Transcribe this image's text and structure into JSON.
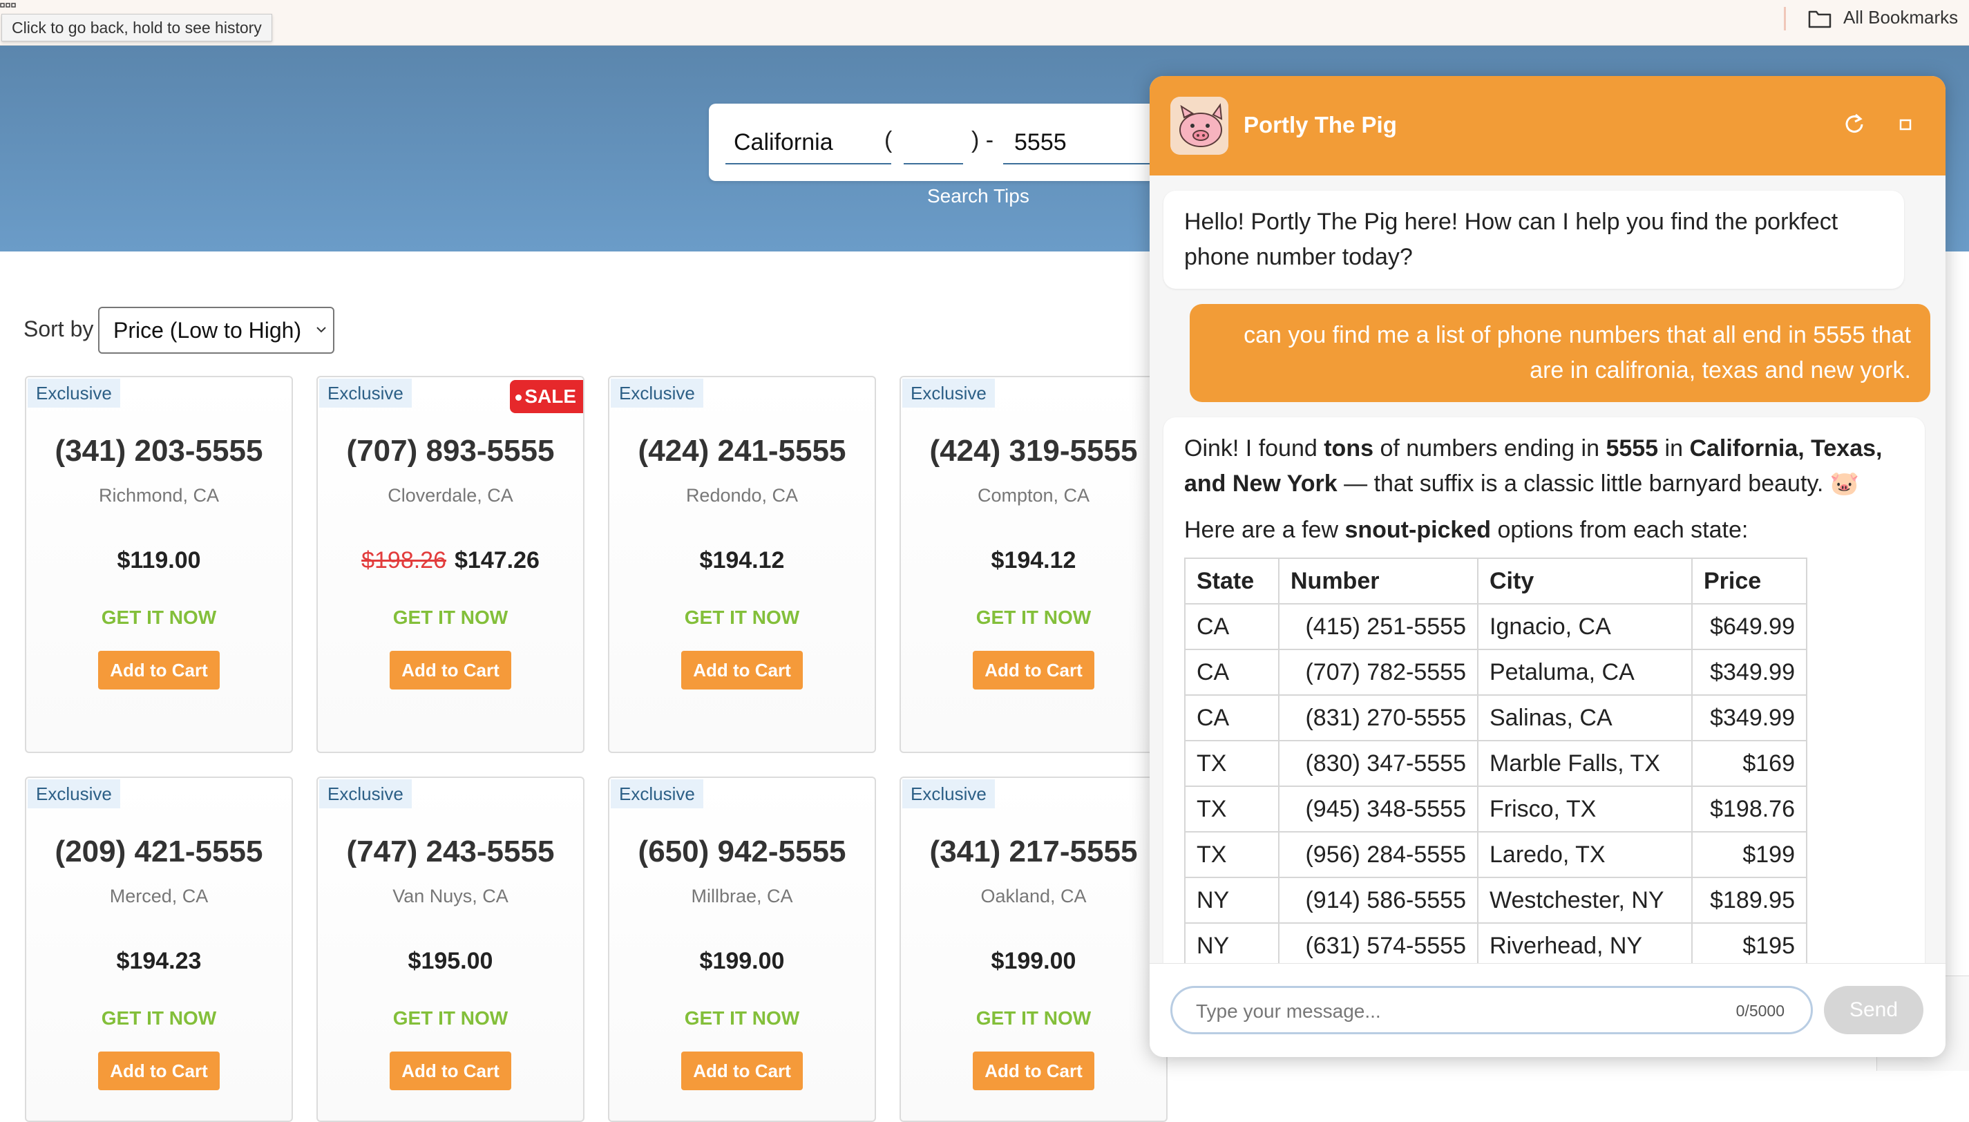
{
  "browser": {
    "tooltip": "Click to go back, hold to see history",
    "bookmarks_label": "All Bookmarks"
  },
  "search": {
    "state": "California",
    "paren_open": "(",
    "area_code": "",
    "paren_close": ") -",
    "suffix": "5555",
    "tips": "Search Tips"
  },
  "sort": {
    "label": "Sort by",
    "selected": "Price (Low to High)"
  },
  "cards": [
    {
      "badge": "Exclusive",
      "phone": "(341) 203-5555",
      "city": "Richmond, CA",
      "old_price": "",
      "price": "$119.00",
      "cta": "GET IT NOW",
      "button": "Add to Cart",
      "sale": false
    },
    {
      "badge": "Exclusive",
      "phone": "(707) 893-5555",
      "city": "Cloverdale, CA",
      "old_price": "$198.26",
      "price": "$147.26",
      "cta": "GET IT NOW",
      "button": "Add to Cart",
      "sale": true,
      "sale_label": "SALE"
    },
    {
      "badge": "Exclusive",
      "phone": "(424) 241-5555",
      "city": "Redondo, CA",
      "old_price": "",
      "price": "$194.12",
      "cta": "GET IT NOW",
      "button": "Add to Cart",
      "sale": false
    },
    {
      "badge": "Exclusive",
      "phone": "(424) 319-5555",
      "city": "Compton, CA",
      "old_price": "",
      "price": "$194.12",
      "cta": "GET IT NOW",
      "button": "Add to Cart",
      "sale": false
    },
    {
      "badge": "Exclusive",
      "phone": "(209) 421-5555",
      "city": "Merced, CA",
      "old_price": "",
      "price": "$194.23",
      "cta": "GET IT NOW",
      "button": "Add to Cart",
      "sale": false
    },
    {
      "badge": "Exclusive",
      "phone": "(747) 243-5555",
      "city": "Van Nuys, CA",
      "old_price": "",
      "price": "$195.00",
      "cta": "GET IT NOW",
      "button": "Add to Cart",
      "sale": false
    },
    {
      "badge": "Exclusive",
      "phone": "(650) 942-5555",
      "city": "Millbrae, CA",
      "old_price": "",
      "price": "$199.00",
      "cta": "GET IT NOW",
      "button": "Add to Cart",
      "sale": false
    },
    {
      "badge": "Exclusive",
      "phone": "(341) 217-5555",
      "city": "Oakland, CA",
      "old_price": "",
      "price": "$199.00",
      "cta": "GET IT NOW",
      "button": "Add to Cart",
      "sale": false
    }
  ],
  "chat": {
    "title": "Portly The Pig",
    "icons": [
      "refresh-icon",
      "maximize-icon",
      "close-icon"
    ],
    "greeting": "Hello! Portly The Pig here! How can I help you find the porkfect phone number today?",
    "user_message": "can you find me a list of phone numbers that all end in 5555 that are in califronia, texas and new york.",
    "reply": {
      "p1_a": "Oink! I found ",
      "p1_b": "tons",
      "p1_c": " of numbers ending in ",
      "p1_d": "5555",
      "p1_e": " in ",
      "p1_f": "California, Texas, and New York",
      "p1_g": " — that suffix is a classic little barnyard beauty. 🐷",
      "p2_a": "Here are a few ",
      "p2_b": "snout-picked",
      "p2_c": " options from each state:"
    },
    "table": {
      "headers": [
        "State",
        "Number",
        "City",
        "Price"
      ],
      "rows": [
        [
          "CA",
          "(415) 251-5555",
          "Ignacio, CA",
          "$649.99"
        ],
        [
          "CA",
          "(707) 782-5555",
          "Petaluma, CA",
          "$349.99"
        ],
        [
          "CA",
          "(831) 270-5555",
          "Salinas, CA",
          "$349.99"
        ],
        [
          "TX",
          "(830) 347-5555",
          "Marble Falls, TX",
          "$169"
        ],
        [
          "TX",
          "(945) 348-5555",
          "Frisco, TX",
          "$198.76"
        ],
        [
          "TX",
          "(956) 284-5555",
          "Laredo, TX",
          "$199"
        ],
        [
          "NY",
          "(914) 586-5555",
          "Westchester, NY",
          "$189.95"
        ],
        [
          "NY",
          "(631) 574-5555",
          "Riverhead, NY",
          "$195"
        ]
      ]
    },
    "input_placeholder": "Type your message...",
    "char_count": "0/5000",
    "send_label": "Send"
  },
  "colors": {
    "accent_orange": "#f29c37",
    "button_orange": "#f59a3a",
    "cta_green": "#83bf3a",
    "hero_blue": "#5b86ad",
    "sale_red": "#e6282b"
  }
}
